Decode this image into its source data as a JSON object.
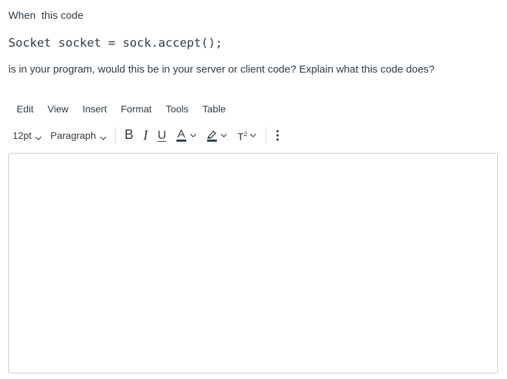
{
  "question": {
    "intro": "When  this code",
    "code": "Socket socket = sock.accept();",
    "body": "is in your program, would this be in your server or client code? Explain what this code does?"
  },
  "menubar": {
    "items": [
      "Edit",
      "View",
      "Insert",
      "Format",
      "Tools",
      "Table"
    ]
  },
  "toolbar": {
    "font_size": "12pt",
    "block_format": "Paragraph",
    "bold_label": "B",
    "italic_label": "I",
    "underline_label": "U",
    "superscript_label": "T",
    "superscript_mark": "2",
    "icons": {
      "font_color": "text-color-icon",
      "highlight": "highlighter-icon",
      "more": "vertical-ellipsis-icon",
      "dropdown": "chevron-down-icon"
    },
    "font_color_bar": "#2d3b45",
    "highlight_bar": "#2d3b45"
  },
  "editor": {
    "value": ""
  }
}
